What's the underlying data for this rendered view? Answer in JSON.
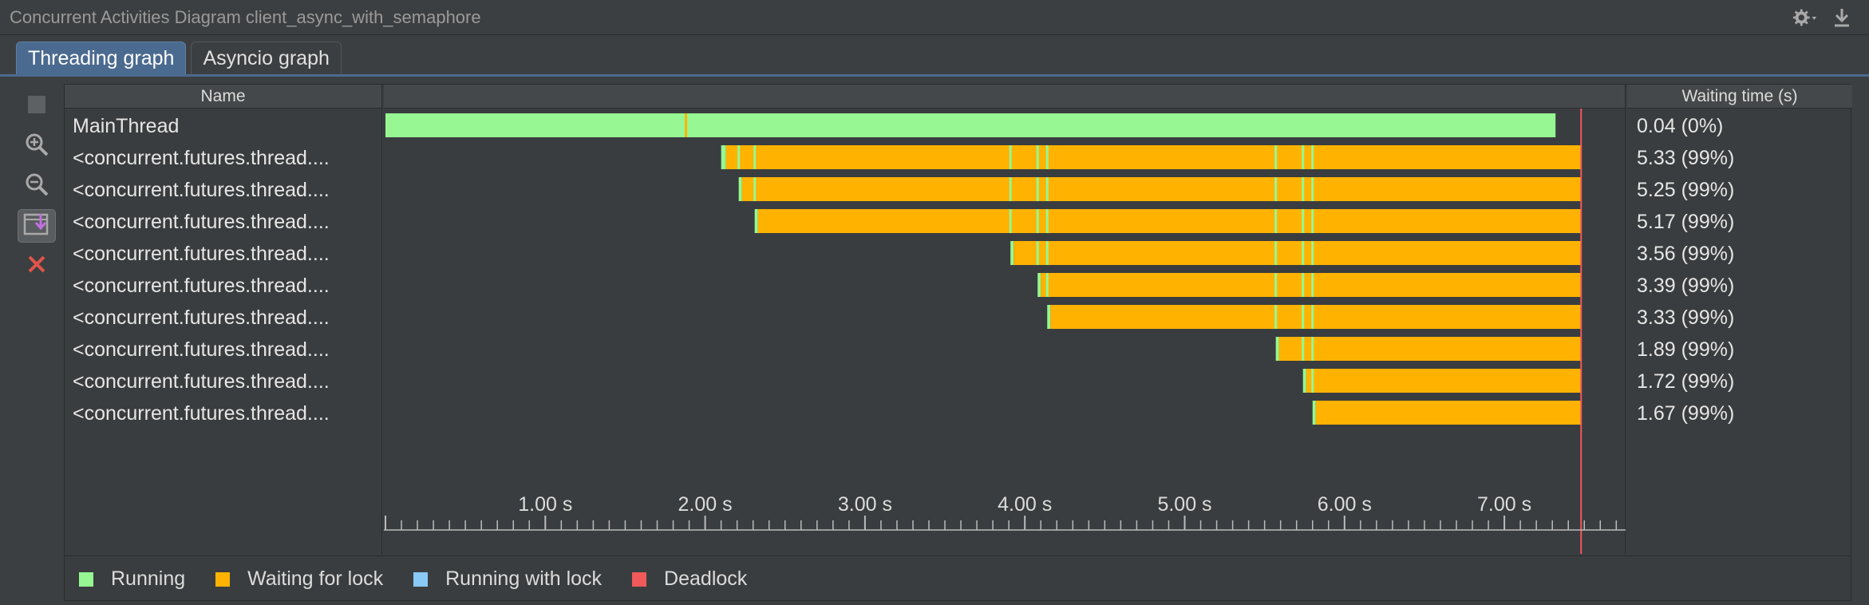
{
  "window": {
    "title": "Concurrent Activities Diagram client_async_with_semaphore",
    "icons": [
      "gear-dropdown-icon",
      "download-icon"
    ]
  },
  "tabs": [
    {
      "label": "Threading graph",
      "active": true
    },
    {
      "label": "Asyncio graph",
      "active": false
    }
  ],
  "toolbar": [
    "stop-icon",
    "zoom-in-icon",
    "zoom-out-icon",
    "scroll-to-end-icon",
    "close-icon"
  ],
  "table": {
    "name_header": "Name",
    "wait_header": "Waiting time (s)",
    "rows": [
      {
        "name": "MainThread",
        "wait": "0.04 (0%)"
      },
      {
        "name": "<concurrent.futures.thread....",
        "wait": "5.33 (99%)"
      },
      {
        "name": "<concurrent.futures.thread....",
        "wait": "5.25 (99%)"
      },
      {
        "name": "<concurrent.futures.thread....",
        "wait": "5.17 (99%)"
      },
      {
        "name": "<concurrent.futures.thread....",
        "wait": "3.56 (99%)"
      },
      {
        "name": "<concurrent.futures.thread....",
        "wait": "3.39 (99%)"
      },
      {
        "name": "<concurrent.futures.thread....",
        "wait": "3.33 (99%)"
      },
      {
        "name": "<concurrent.futures.thread....",
        "wait": "1.89 (99%)"
      },
      {
        "name": "<concurrent.futures.thread....",
        "wait": "1.72 (99%)"
      },
      {
        "name": "<concurrent.futures.thread....",
        "wait": "1.67 (99%)"
      }
    ]
  },
  "timeline": {
    "x_range": [
      0,
      7.78
    ],
    "tick_labels": [
      "1.00 s",
      "2.00 s",
      "3.00 s",
      "4.00 s",
      "5.00 s",
      "6.00 s",
      "7.00 s"
    ],
    "tick_values": [
      1,
      2,
      3,
      4,
      5,
      6,
      7
    ],
    "minor_step": 0.1,
    "end_marker": 7.48,
    "threads": [
      {
        "segments": [
          {
            "state": "running",
            "start": 0,
            "end": 7.32
          }
        ],
        "events": [
          1.88
        ]
      },
      {
        "segments": [
          {
            "state": "running",
            "start": 2.1,
            "end": 2.13
          },
          {
            "state": "waiting",
            "start": 2.13,
            "end": 7.48
          }
        ],
        "events": [
          2.21,
          2.31,
          3.91,
          4.08,
          4.14,
          5.57,
          5.74,
          5.8
        ]
      },
      {
        "segments": [
          {
            "state": "running",
            "start": 2.21,
            "end": 2.23
          },
          {
            "state": "waiting",
            "start": 2.23,
            "end": 7.48
          }
        ],
        "events": [
          2.31,
          3.91,
          4.08,
          4.14,
          5.57,
          5.74,
          5.8
        ]
      },
      {
        "segments": [
          {
            "state": "running",
            "start": 2.31,
            "end": 2.33
          },
          {
            "state": "waiting",
            "start": 2.33,
            "end": 7.48
          }
        ],
        "events": [
          3.91,
          4.08,
          4.14,
          5.57,
          5.74,
          5.8
        ]
      },
      {
        "segments": [
          {
            "state": "running",
            "start": 3.91,
            "end": 3.93
          },
          {
            "state": "waiting",
            "start": 3.93,
            "end": 7.48
          }
        ],
        "events": [
          4.08,
          4.14,
          5.57,
          5.74,
          5.8
        ]
      },
      {
        "segments": [
          {
            "state": "running",
            "start": 4.08,
            "end": 4.1
          },
          {
            "state": "waiting",
            "start": 4.1,
            "end": 7.48
          }
        ],
        "events": [
          4.14,
          5.57,
          5.74,
          5.8
        ]
      },
      {
        "segments": [
          {
            "state": "running",
            "start": 4.14,
            "end": 4.16
          },
          {
            "state": "waiting",
            "start": 4.16,
            "end": 7.48
          }
        ],
        "events": [
          5.57,
          5.74,
          5.8
        ]
      },
      {
        "segments": [
          {
            "state": "running",
            "start": 5.57,
            "end": 5.59
          },
          {
            "state": "waiting",
            "start": 5.59,
            "end": 7.48
          }
        ],
        "events": [
          5.74,
          5.8
        ]
      },
      {
        "segments": [
          {
            "state": "running",
            "start": 5.74,
            "end": 5.76
          },
          {
            "state": "waiting",
            "start": 5.76,
            "end": 7.48
          }
        ],
        "events": [
          5.8
        ]
      },
      {
        "segments": [
          {
            "state": "running",
            "start": 5.8,
            "end": 5.82
          },
          {
            "state": "waiting",
            "start": 5.82,
            "end": 7.48
          }
        ],
        "events": []
      }
    ]
  },
  "legend": [
    {
      "label": "Running",
      "color": "#96f793"
    },
    {
      "label": "Waiting for lock",
      "color": "#ffb300"
    },
    {
      "label": "Running with lock",
      "color": "#8ac8f5"
    },
    {
      "label": "Deadlock",
      "color": "#f05a5a"
    }
  ],
  "colors": {
    "running": "#96f793",
    "waiting": "#ffb300",
    "accent": "#4b6a8f",
    "deadline": "#f05a5a"
  }
}
